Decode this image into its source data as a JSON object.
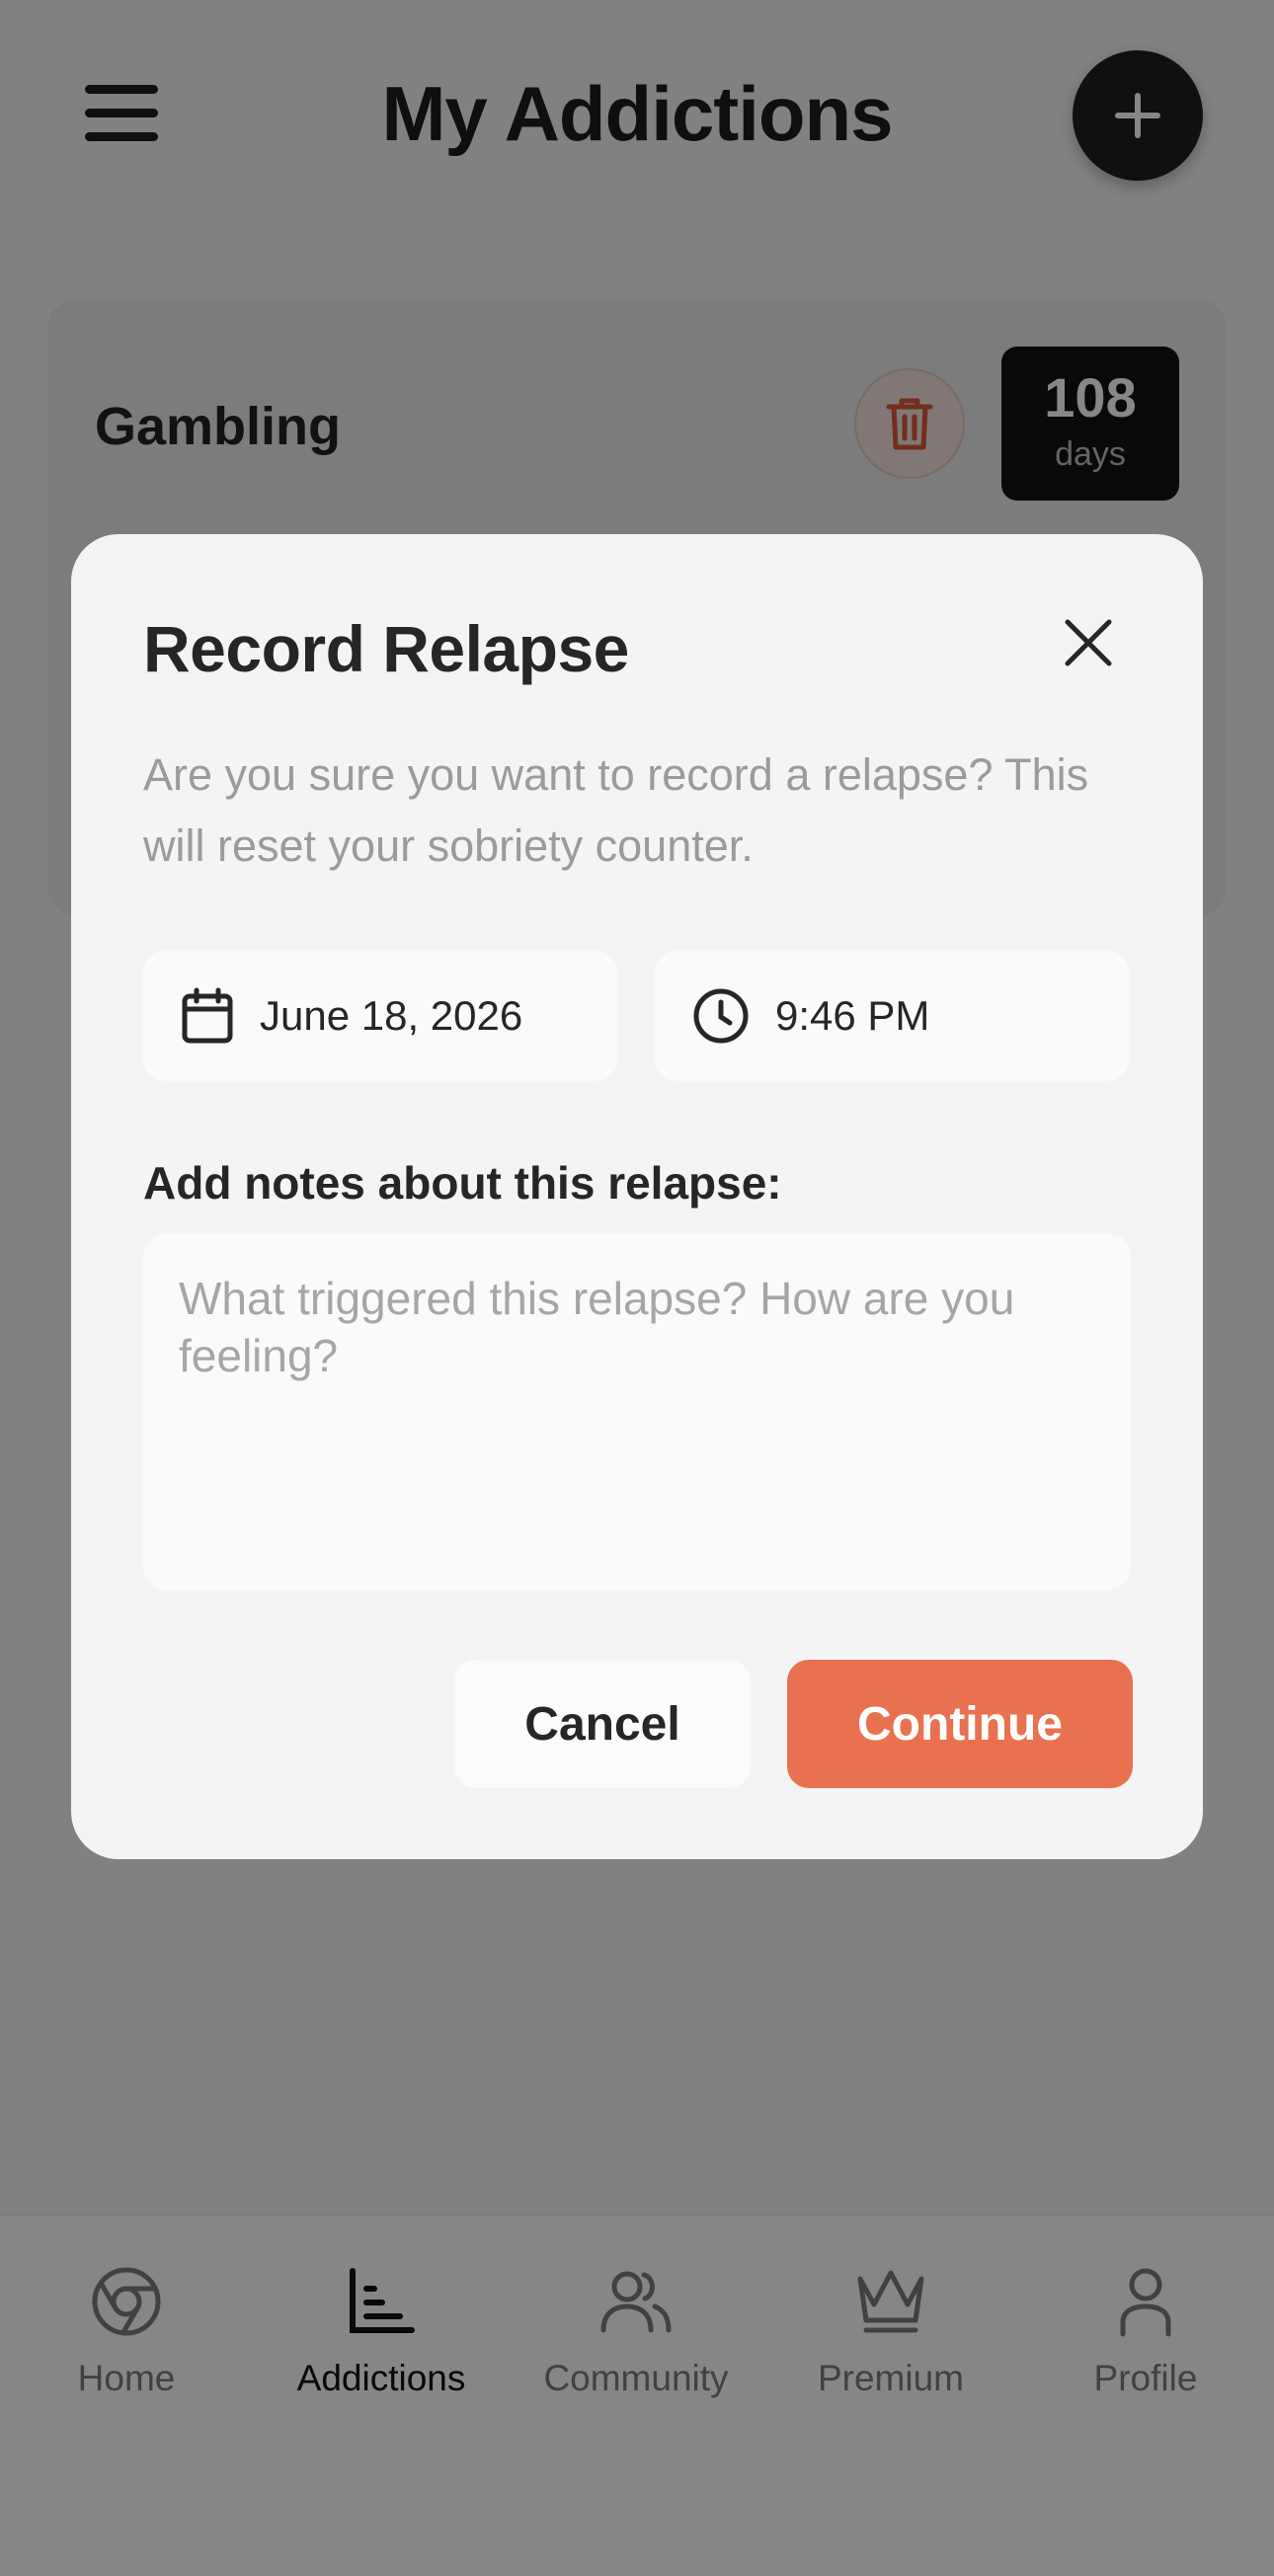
{
  "header": {
    "title": "My Addictions",
    "menu_icon": "hamburger-icon",
    "add_icon": "plus-icon"
  },
  "addiction_card": {
    "name": "Gambling",
    "days_count": "108",
    "days_label": "days",
    "delete_icon": "trash-icon"
  },
  "modal": {
    "title": "Record Relapse",
    "message": "Are you sure you want to record a relapse? This will reset your sobriety counter.",
    "date_value": "June 18, 2026",
    "time_value": "9:46 PM",
    "notes_label": "Add notes about this relapse:",
    "notes_value": "",
    "notes_placeholder": "What triggered this relapse? How are you feeling?",
    "cancel_label": "Cancel",
    "continue_label": "Continue"
  },
  "bottom_nav": {
    "items": [
      {
        "label": "Home",
        "icon": "home-icon"
      },
      {
        "label": "Addictions",
        "icon": "chart-icon",
        "active": true
      },
      {
        "label": "Community",
        "icon": "community-icon"
      },
      {
        "label": "Premium",
        "icon": "crown-icon"
      },
      {
        "label": "Profile",
        "icon": "profile-icon"
      }
    ]
  },
  "colors": {
    "accent": "#e9714f",
    "dark": "#1f1f1f",
    "overlay": "#000000"
  }
}
